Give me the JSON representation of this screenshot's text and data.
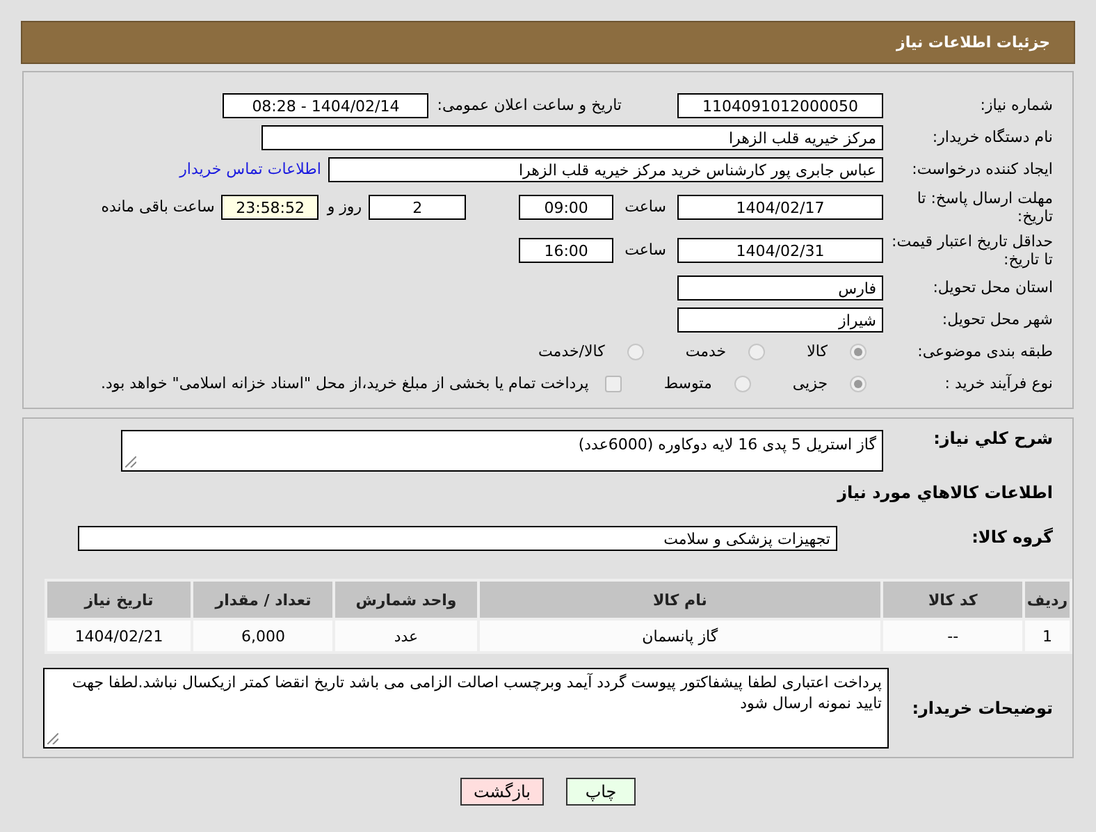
{
  "header": {
    "title": "جزئیات اطلاعات نیاز"
  },
  "need_number": {
    "label": "شماره نیاز:",
    "value": "1104091012000050"
  },
  "announce": {
    "label": "تاریخ و ساعت اعلان عمومی:",
    "value": "1404/02/14 - 08:28"
  },
  "buyer_org": {
    "label": "نام دستگاه خریدار:",
    "value": "مرکز خیریه قلب الزهرا"
  },
  "creator": {
    "label": "ایجاد کننده درخواست:",
    "value": "عباس جابری پور کارشناس خرید مرکز خیریه قلب الزهرا",
    "link": "اطلاعات تماس خریدار"
  },
  "reply_deadline": {
    "label": "مهلت ارسال پاسخ: تا تاریخ:",
    "date": "1404/02/17",
    "time_label": "ساعت",
    "time": "09:00",
    "days": "2",
    "days_label": "روز و",
    "remaining": "23:58:52",
    "remaining_label": "ساعت باقی مانده"
  },
  "price_validity": {
    "label": "حداقل تاریخ اعتبار قیمت: تا تاریخ:",
    "date": "1404/02/31",
    "time_label": "ساعت",
    "time": "16:00"
  },
  "province": {
    "label": "استان محل تحویل:",
    "value": "فارس"
  },
  "city": {
    "label": "شهر محل تحویل:",
    "value": "شیراز"
  },
  "category": {
    "label": "طبقه بندی موضوعی:",
    "options": [
      {
        "label": "کالا",
        "selected": true
      },
      {
        "label": "خدمت",
        "selected": false
      },
      {
        "label": "کالا/خدمت",
        "selected": false
      }
    ]
  },
  "process": {
    "label": "نوع فرآیند خرید :",
    "options": [
      {
        "label": "جزیی",
        "selected": true
      },
      {
        "label": "متوسط",
        "selected": false
      }
    ],
    "payment": {
      "checked": false,
      "label": "پرداخت تمام یا بخشی از مبلغ خرید،از محل \"اسناد خزانه اسلامی\" خواهد بود."
    }
  },
  "description": {
    "label": "شرح کلي نياز:",
    "value": "گاز استریل 5 پدی 16 لایه دوکاوره    (6000عدد)"
  },
  "items_heading": "اطلاعات کالاهاي مورد نياز",
  "goods_group": {
    "label": "گروه کالا:",
    "value": "تجهیزات پزشکی و سلامت"
  },
  "table": {
    "columns": [
      "ردیف",
      "کد کالا",
      "نام کالا",
      "واحد شمارش",
      "تعداد / مقدار",
      "تاریخ نیاز"
    ],
    "rows": [
      [
        "1",
        "--",
        "گاز پانسمان",
        "عدد",
        "6,000",
        "1404/02/21"
      ]
    ]
  },
  "buyer_notes": {
    "label": "توضیحات خریدار:",
    "value": "پرداخت اعتباری لطفا پیشفاکتور پیوست گردد آیمد وبرچسب اصالت الزامی می باشد تاریخ انقضا کمتر ازیکسال نباشد.لطفا جهت تایید نمونه ارسال شود"
  },
  "buttons": [
    {
      "label": "چاپ",
      "kind": "print"
    },
    {
      "label": "بازگشت",
      "kind": "back"
    }
  ]
}
